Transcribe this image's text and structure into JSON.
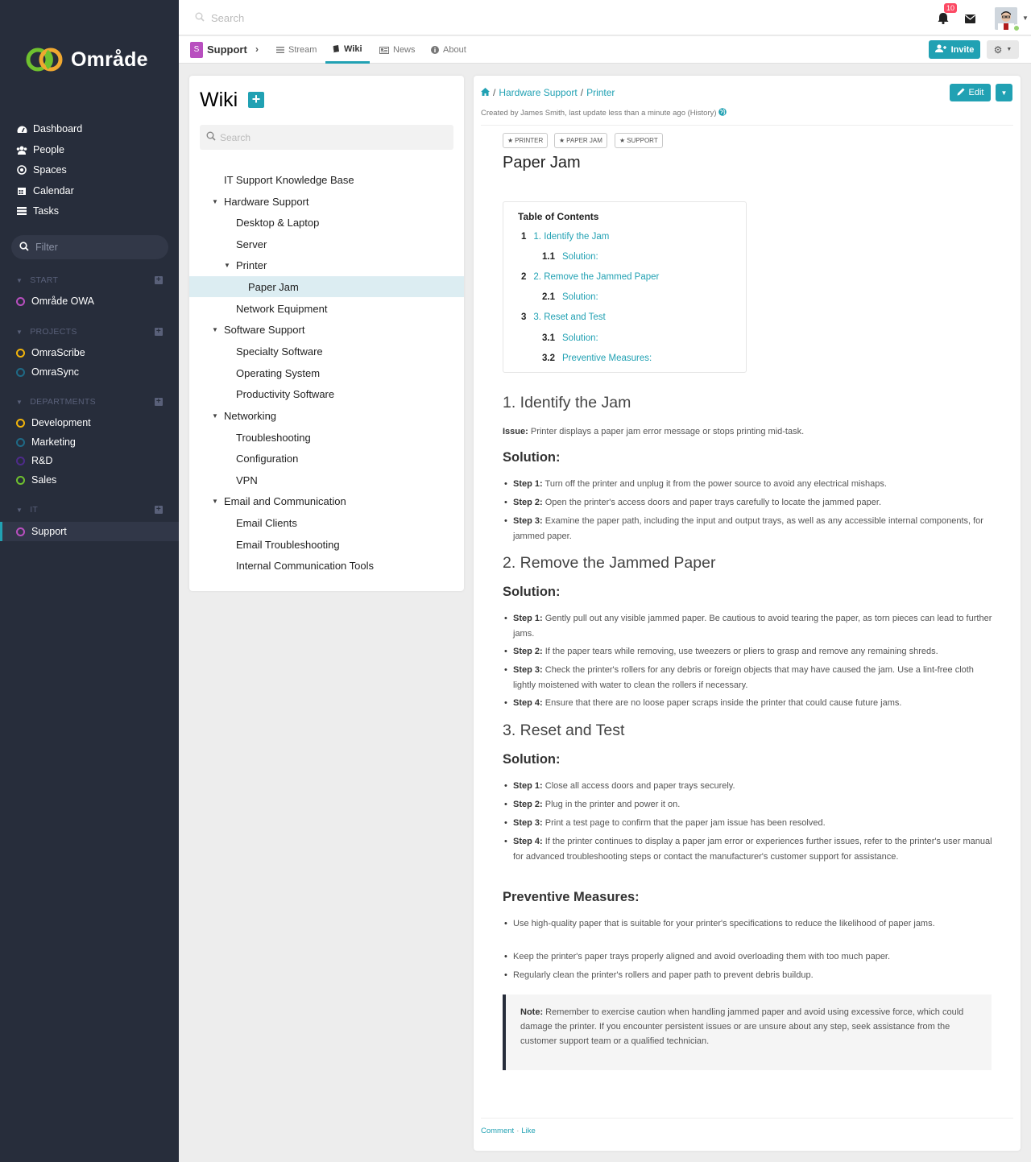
{
  "app": {
    "name": "Område"
  },
  "topbar": {
    "search_placeholder": "Search",
    "notification_count": "10"
  },
  "sidebar": {
    "nav": [
      {
        "label": "Dashboard",
        "icon": "dashboard-icon"
      },
      {
        "label": "People",
        "icon": "people-icon"
      },
      {
        "label": "Spaces",
        "icon": "spaces-icon"
      },
      {
        "label": "Calendar",
        "icon": "calendar-icon"
      },
      {
        "label": "Tasks",
        "icon": "tasks-icon"
      }
    ],
    "filter_placeholder": "Filter",
    "sections": [
      {
        "title": "START",
        "items": [
          {
            "label": "Område OWA",
            "color": "#b84fbf"
          }
        ]
      },
      {
        "title": "PROJECTS",
        "items": [
          {
            "label": "OmraScribe",
            "color": "#f0b30c"
          },
          {
            "label": "OmraSync",
            "color": "#1f6a86"
          }
        ]
      },
      {
        "title": "DEPARTMENTS",
        "items": [
          {
            "label": "Development",
            "color": "#f0b30c"
          },
          {
            "label": "Marketing",
            "color": "#1f6a86"
          },
          {
            "label": "R&D",
            "color": "#4e2b8a"
          },
          {
            "label": "Sales",
            "color": "#6fc12f"
          }
        ]
      },
      {
        "title": "IT",
        "items": [
          {
            "label": "Support",
            "color": "#b84fbf",
            "active": true
          }
        ]
      }
    ]
  },
  "space": {
    "badge": "S",
    "name": "Support"
  },
  "tabs": [
    {
      "label": "Stream",
      "icon": "stream-icon"
    },
    {
      "label": "Wiki",
      "icon": "book-icon",
      "active": true
    },
    {
      "label": "News",
      "icon": "news-icon"
    },
    {
      "label": "About",
      "icon": "info-icon"
    }
  ],
  "header_buttons": {
    "invite": "Invite"
  },
  "wiki": {
    "title": "Wiki",
    "search_placeholder": "Search",
    "tree": [
      {
        "label": "IT Support Knowledge Base",
        "level": 0,
        "caret": false
      },
      {
        "label": "Hardware Support",
        "level": 0,
        "caret": true
      },
      {
        "label": "Desktop & Laptop",
        "level": 1,
        "caret": false
      },
      {
        "label": "Server",
        "level": 1,
        "caret": false
      },
      {
        "label": "Printer",
        "level": 1,
        "caret": true
      },
      {
        "label": "Paper Jam",
        "level": 2,
        "caret": false,
        "active": true
      },
      {
        "label": "Network Equipment",
        "level": 1,
        "caret": false
      },
      {
        "label": "Software Support",
        "level": 0,
        "caret": true
      },
      {
        "label": "Specialty Software",
        "level": 1,
        "caret": false
      },
      {
        "label": "Operating System",
        "level": 1,
        "caret": false
      },
      {
        "label": "Productivity Software",
        "level": 1,
        "caret": false
      },
      {
        "label": "Networking",
        "level": 0,
        "caret": true
      },
      {
        "label": "Troubleshooting",
        "level": 1,
        "caret": false
      },
      {
        "label": "Configuration",
        "level": 1,
        "caret": false
      },
      {
        "label": "VPN",
        "level": 1,
        "caret": false
      },
      {
        "label": "Email and Communication",
        "level": 0,
        "caret": true
      },
      {
        "label": "Email Clients",
        "level": 1,
        "caret": false
      },
      {
        "label": "Email Troubleshooting",
        "level": 1,
        "caret": false
      },
      {
        "label": "Internal Communication Tools",
        "level": 1,
        "caret": false
      }
    ]
  },
  "page": {
    "breadcrumb": [
      "Hardware Support",
      "Printer"
    ],
    "created": "Created by James Smith, last update less than a minute ago (History)",
    "edit_label": "Edit",
    "tags": [
      "PRINTER",
      "PAPER JAM",
      "SUPPORT"
    ],
    "title": "Paper Jam",
    "toc_title": "Table of Contents",
    "toc": [
      {
        "num": "1",
        "label": "1. Identify the Jam",
        "level": 0
      },
      {
        "num": "1.1",
        "label": "Solution:",
        "level": 1
      },
      {
        "num": "2",
        "label": "2. Remove the Jammed Paper",
        "level": 0
      },
      {
        "num": "2.1",
        "label": "Solution:",
        "level": 1
      },
      {
        "num": "3",
        "label": "3. Reset and Test",
        "level": 0
      },
      {
        "num": "3.1",
        "label": "Solution:",
        "level": 1
      },
      {
        "num": "3.2",
        "label": "Preventive Measures:",
        "level": 1
      }
    ],
    "sections": [
      {
        "heading": "1. Identify the Jam",
        "issue_label": "Issue:",
        "issue": " Printer displays a paper jam error message or stops printing mid-task.",
        "sub": "Solution:",
        "steps": [
          {
            "b": "Step 1:",
            "t": " Turn off the printer and unplug it from the power source to avoid any electrical mishaps."
          },
          {
            "b": "Step 2:",
            "t": " Open the printer's access doors and paper trays carefully to locate the jammed paper."
          },
          {
            "b": "Step 3:",
            "t": " Examine the paper path, including the input and output trays, as well as any accessible internal components, for jammed paper."
          }
        ]
      },
      {
        "heading": "2. Remove the Jammed Paper",
        "sub": "Solution:",
        "steps": [
          {
            "b": "Step 1:",
            "t": " Gently pull out any visible jammed paper. Be cautious to avoid tearing the paper, as torn pieces can lead to further jams."
          },
          {
            "b": "Step 2:",
            "t": " If the paper tears while removing, use tweezers or pliers to grasp and remove any remaining shreds."
          },
          {
            "b": "Step 3:",
            "t": " Check the printer's rollers for any debris or foreign objects that may have caused the jam. Use a lint-free cloth lightly moistened with water to clean the rollers if necessary."
          },
          {
            "b": "Step 4:",
            "t": " Ensure that there are no loose paper scraps inside the printer that could cause future jams."
          }
        ]
      },
      {
        "heading": "3. Reset and Test",
        "sub": "Solution:",
        "steps": [
          {
            "b": "Step 1:",
            "t": " Close all access doors and paper trays securely."
          },
          {
            "b": "Step 2:",
            "t": " Plug in the printer and power it on."
          },
          {
            "b": "Step 3:",
            "t": " Print a test page to confirm that the paper jam issue has been resolved."
          },
          {
            "b": "Step 4:",
            "t": " If the printer continues to display a paper jam error or experiences further issues, refer to the printer's user manual for advanced troubleshooting steps or contact the manufacturer's customer support for assistance."
          }
        ]
      }
    ],
    "preventive_heading": "Preventive Measures:",
    "preventive": [
      "Use high-quality paper that is suitable for your printer's specifications to reduce the likelihood of paper jams.",
      "Keep the printer's paper trays properly aligned and avoid overloading them with too much paper.",
      "Regularly clean the printer's rollers and paper path to prevent debris buildup."
    ],
    "note_label": "Note:",
    "note": " Remember to exercise caution when handling jammed paper and avoid using excessive force, which could damage the printer. If you encounter persistent issues or are unsure about any step, seek assistance from the customer support team or a qualified technician.",
    "footer": {
      "comment": "Comment",
      "like": "Like"
    }
  }
}
